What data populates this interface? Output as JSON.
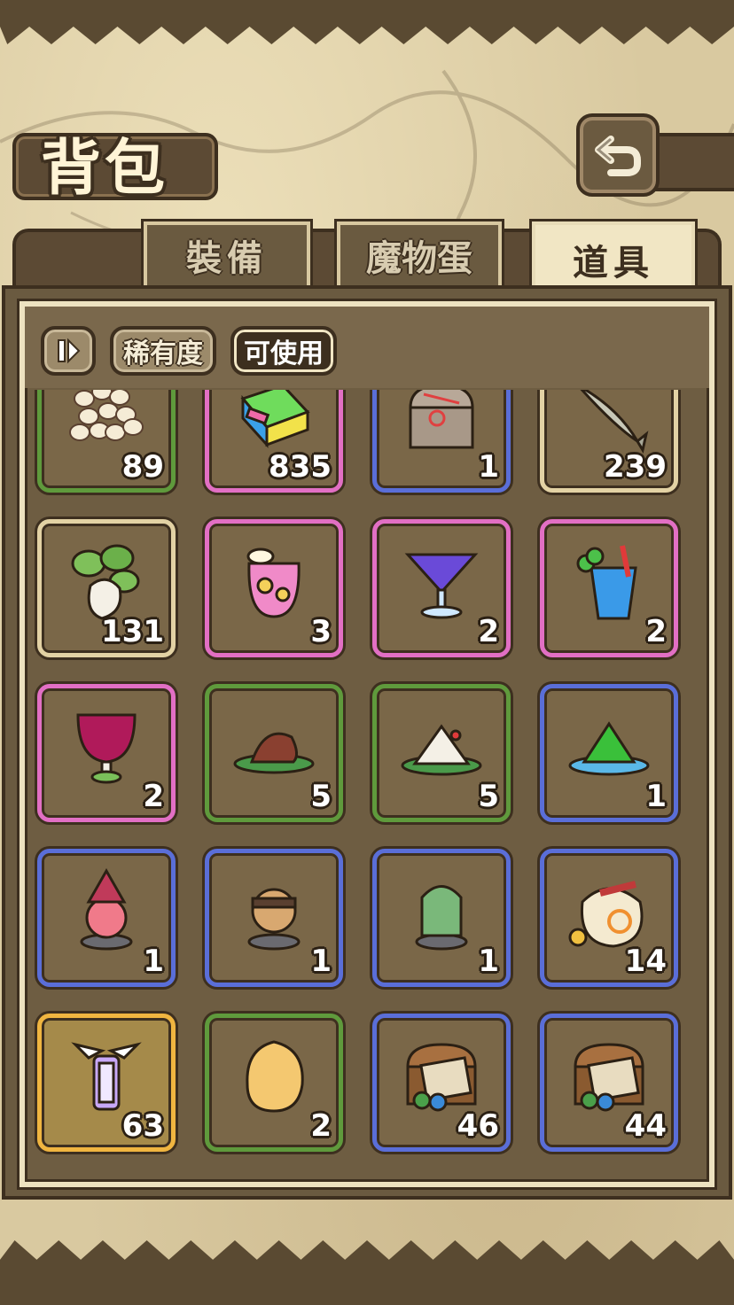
{
  "header": {
    "title": "背包"
  },
  "tabs": [
    {
      "label": "裝備",
      "active": false
    },
    {
      "label": "魔物蛋",
      "active": false
    },
    {
      "label": "道具",
      "active": true
    }
  ],
  "filters": [
    {
      "label": "稀有度",
      "active": false
    },
    {
      "label": "可使用",
      "active": true
    }
  ],
  "items": [
    {
      "name": "seeds-icon",
      "qty": "89",
      "rarity": "green"
    },
    {
      "name": "eraser-block-icon",
      "qty": "835",
      "rarity": "pink"
    },
    {
      "name": "stone-chest-icon",
      "qty": "1",
      "rarity": "blue"
    },
    {
      "name": "fish-icon",
      "qty": "239",
      "rarity": "tan"
    },
    {
      "name": "radish-icon",
      "qty": "131",
      "rarity": "tan"
    },
    {
      "name": "fruit-soda-icon",
      "qty": "3",
      "rarity": "pink"
    },
    {
      "name": "cocktail-glass-icon",
      "qty": "2",
      "rarity": "pink"
    },
    {
      "name": "clover-drink-icon",
      "qty": "2",
      "rarity": "pink"
    },
    {
      "name": "red-goblet-icon",
      "qty": "2",
      "rarity": "pink"
    },
    {
      "name": "meat-dumpling-icon",
      "qty": "5",
      "rarity": "green"
    },
    {
      "name": "rice-dumpling-icon",
      "qty": "5",
      "rarity": "green"
    },
    {
      "name": "green-gem-icon",
      "qty": "1",
      "rarity": "blue"
    },
    {
      "name": "witch-figure-icon",
      "qty": "1",
      "rarity": "blue"
    },
    {
      "name": "ninja-figure-icon",
      "qty": "1",
      "rarity": "blue"
    },
    {
      "name": "knight-figure-icon",
      "qty": "1",
      "rarity": "blue"
    },
    {
      "name": "coin-sack-icon",
      "qty": "14",
      "rarity": "blue"
    },
    {
      "name": "winged-lantern-icon",
      "qty": "63",
      "rarity": "gold"
    },
    {
      "name": "potato-icon",
      "qty": "2",
      "rarity": "green"
    },
    {
      "name": "treasure-chest-scroll-icon",
      "qty": "46",
      "rarity": "blue"
    },
    {
      "name": "treasure-chest-scroll-icon",
      "qty": "44",
      "rarity": "blue"
    }
  ]
}
